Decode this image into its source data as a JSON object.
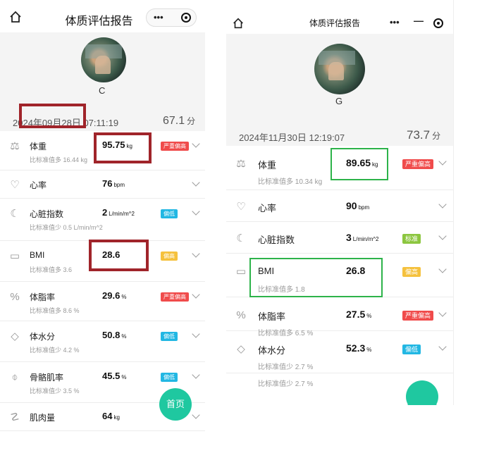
{
  "left": {
    "title": "体质评估报告",
    "user_name": "C",
    "datetime": "2024年09月28日 07:11:19",
    "score": "67.1",
    "score_unit": "分",
    "fab_label": "首页",
    "metrics": [
      {
        "name": "体重",
        "value": "95.75",
        "unit": "kg",
        "badge": "严重偏高",
        "badge_color": "#f04b4b",
        "sub": "比标准值多 16.44 kg",
        "icon": "scale-icon"
      },
      {
        "name": "心率",
        "value": "76",
        "unit": "bpm",
        "badge": "",
        "sub": "",
        "icon": "heart-icon"
      },
      {
        "name": "心脏指数",
        "value": "2",
        "unit": "L/min/m^2",
        "badge": "偏低",
        "badge_color": "#22b7e3",
        "sub": "比标准值少 0.5 L/min/m^2",
        "icon": "heart-index-icon"
      },
      {
        "name": "BMI",
        "value": "28.6",
        "unit": "",
        "badge": "偏高",
        "badge_color": "#f5c13d",
        "sub": "比标准值多 3.6",
        "icon": "ruler-icon"
      },
      {
        "name": "体脂率",
        "value": "29.6",
        "unit": "%",
        "badge": "严重偏高",
        "badge_color": "#f04b4b",
        "sub": "比标准值多 8.6 %",
        "icon": "percent-icon"
      },
      {
        "name": "体水分",
        "value": "50.8",
        "unit": "%",
        "badge": "偏低",
        "badge_color": "#22b7e3",
        "sub": "比标准值少 4.2 %",
        "icon": "water-drop-icon"
      },
      {
        "name": "骨骼肌率",
        "value": "45.5",
        "unit": "%",
        "badge": "偏低",
        "badge_color": "#22b7e3",
        "sub": "比标准值少 3.5 %",
        "icon": "bone-icon"
      },
      {
        "name": "肌肉量",
        "value": "64",
        "unit": "kg",
        "badge": "",
        "sub": "",
        "icon": "muscle-icon"
      }
    ]
  },
  "right": {
    "title": "体质评估报告",
    "user_name": "G",
    "datetime": "2024年11月30日 12:19:07",
    "score": "73.7",
    "score_unit": "分",
    "metrics": [
      {
        "name": "体重",
        "value": "89.65",
        "unit": "kg",
        "badge": "严重偏高",
        "badge_color": "#f04b4b",
        "sub": "比标准值多 10.34 kg",
        "icon": "scale-icon"
      },
      {
        "name": "心率",
        "value": "90",
        "unit": "bpm",
        "badge": "",
        "sub": "",
        "icon": "heart-icon"
      },
      {
        "name": "心脏指数",
        "value": "3",
        "unit": "L/min/m^2",
        "badge": "标准",
        "badge_color": "#8cc63f",
        "sub": "",
        "icon": "heart-index-icon"
      },
      {
        "name": "BMI",
        "value": "26.8",
        "unit": "",
        "badge": "偏高",
        "badge_color": "#f5c13d",
        "sub": "比标准值多 1.8",
        "icon": "ruler-icon"
      },
      {
        "name": "体脂率",
        "value": "27.5",
        "unit": "%",
        "badge": "严重偏高",
        "badge_color": "#f04b4b",
        "sub": "比标准值多 6.5 %",
        "icon": "percent-icon"
      },
      {
        "name": "体水分",
        "value": "52.3",
        "unit": "%",
        "badge": "偏低",
        "badge_color": "#22b7e3",
        "sub": "比标准值少 2.7 %",
        "sub2": "比标准值少 2.7 %",
        "icon": "water-drop-icon"
      }
    ]
  }
}
